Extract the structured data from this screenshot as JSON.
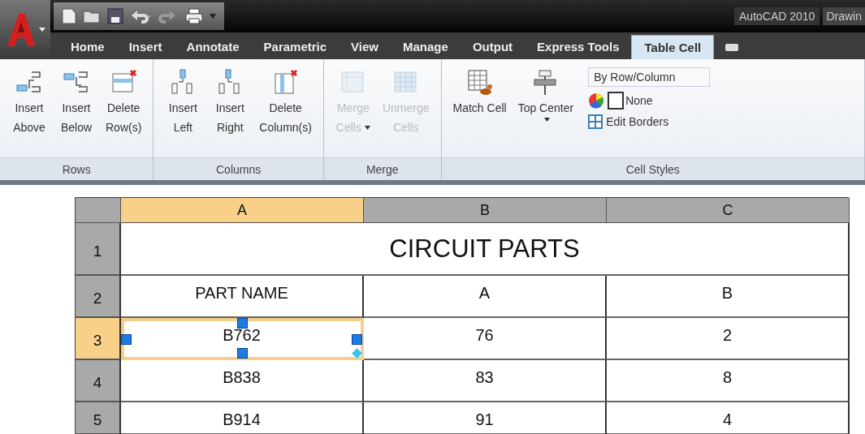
{
  "title_bar": {
    "app_title": "AutoCAD 2010",
    "document": "Drawin"
  },
  "tabs": [
    {
      "label": "Home",
      "selected": false
    },
    {
      "label": "Insert",
      "selected": false
    },
    {
      "label": "Annotate",
      "selected": false
    },
    {
      "label": "Parametric",
      "selected": false
    },
    {
      "label": "View",
      "selected": false
    },
    {
      "label": "Manage",
      "selected": false
    },
    {
      "label": "Output",
      "selected": false
    },
    {
      "label": "Express Tools",
      "selected": false
    },
    {
      "label": "Table Cell",
      "selected": true
    }
  ],
  "panels": [
    {
      "title": "Rows",
      "buttons": [
        {
          "lines": [
            "Insert",
            "Above"
          ],
          "disabled": false,
          "dropdown": false
        },
        {
          "lines": [
            "Insert",
            "Below"
          ],
          "disabled": false,
          "dropdown": false
        },
        {
          "lines": [
            "Delete",
            "Row(s)"
          ],
          "disabled": false,
          "dropdown": false
        }
      ]
    },
    {
      "title": "Columns",
      "buttons": [
        {
          "lines": [
            "Insert",
            "Left"
          ],
          "disabled": false,
          "dropdown": false
        },
        {
          "lines": [
            "Insert",
            "Right"
          ],
          "disabled": false,
          "dropdown": false
        },
        {
          "lines": [
            "Delete",
            "Column(s)"
          ],
          "disabled": false,
          "dropdown": false
        }
      ]
    },
    {
      "title": "Merge",
      "buttons": [
        {
          "lines": [
            "Merge",
            "Cells"
          ],
          "disabled": true,
          "dropdown": true
        },
        {
          "lines": [
            "Unmerge",
            "Cells"
          ],
          "disabled": true,
          "dropdown": false
        }
      ]
    },
    {
      "title": "Cell Styles",
      "buttons": [
        {
          "lines": [
            "Match Cell"
          ],
          "disabled": false,
          "dropdown": false
        },
        {
          "lines": [
            "Top Center"
          ],
          "disabled": false,
          "dropdown": true
        }
      ],
      "style_select": "By Row/Column",
      "fill_color": "None",
      "edit_borders": "Edit Borders"
    }
  ],
  "table": {
    "columns": [
      {
        "label": "A",
        "selected": true
      },
      {
        "label": "B",
        "selected": false
      },
      {
        "label": "C",
        "selected": false
      }
    ],
    "rows": [
      {
        "label": "1",
        "selected": false,
        "cells": [
          {
            "text": "CIRCUIT PARTS",
            "kind": "title",
            "colspan": 3,
            "selected": false
          }
        ]
      },
      {
        "label": "2",
        "selected": false,
        "cells": [
          {
            "text": "PART NAME",
            "kind": "data",
            "selected": false
          },
          {
            "text": "A",
            "kind": "data",
            "selected": false
          },
          {
            "text": "B",
            "kind": "data",
            "selected": false
          }
        ]
      },
      {
        "label": "3",
        "selected": true,
        "cells": [
          {
            "text": "B762",
            "kind": "data",
            "selected": true
          },
          {
            "text": "76",
            "kind": "data",
            "selected": false
          },
          {
            "text": "2",
            "kind": "data",
            "selected": false
          }
        ]
      },
      {
        "label": "4",
        "selected": false,
        "cells": [
          {
            "text": "B838",
            "kind": "data",
            "selected": false
          },
          {
            "text": "83",
            "kind": "data",
            "selected": false
          },
          {
            "text": "8",
            "kind": "data",
            "selected": false
          }
        ]
      },
      {
        "label": "5",
        "selected": false,
        "cells": [
          {
            "text": "B914",
            "kind": "data",
            "selected": false
          },
          {
            "text": "91",
            "kind": "data",
            "selected": false
          },
          {
            "text": "4",
            "kind": "data",
            "selected": false
          }
        ]
      }
    ]
  }
}
